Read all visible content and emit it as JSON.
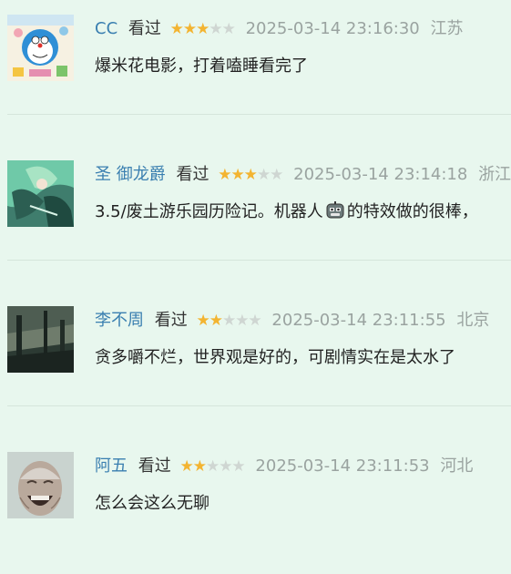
{
  "comments": [
    {
      "name": "CC",
      "status": "看过",
      "rating": 3,
      "max_rating": 5,
      "time": "2025-03-14 23:16:30",
      "location": "江苏",
      "text": "爆米花电影，打着嗑睡看完了"
    },
    {
      "name": "圣 御龙爵",
      "status": "看过",
      "rating": 3,
      "max_rating": 5,
      "time": "2025-03-14 23:14:18",
      "location": "浙江",
      "text_before": "3.5/废土游乐园历险记。机器人",
      "emoji": "robot-face-icon",
      "text_after": "的特效做的很棒，"
    },
    {
      "name": "李不周",
      "status": "看过",
      "rating": 2,
      "max_rating": 5,
      "time": "2025-03-14 23:11:55",
      "location": "北京",
      "text": "贪多嚼不烂，世界观是好的，可剧情实在是太水了"
    },
    {
      "name": "阿五",
      "status": "看过",
      "rating": 2,
      "max_rating": 5,
      "time": "2025-03-14 23:11:53",
      "location": "河北",
      "text": "怎么会这么无聊"
    }
  ],
  "colors": {
    "background": "#e8f7ee",
    "username": "#3a7fb0",
    "star_filled": "#f3b431",
    "star_empty": "#cfd6d2",
    "meta_gray": "#9aa3a0"
  }
}
